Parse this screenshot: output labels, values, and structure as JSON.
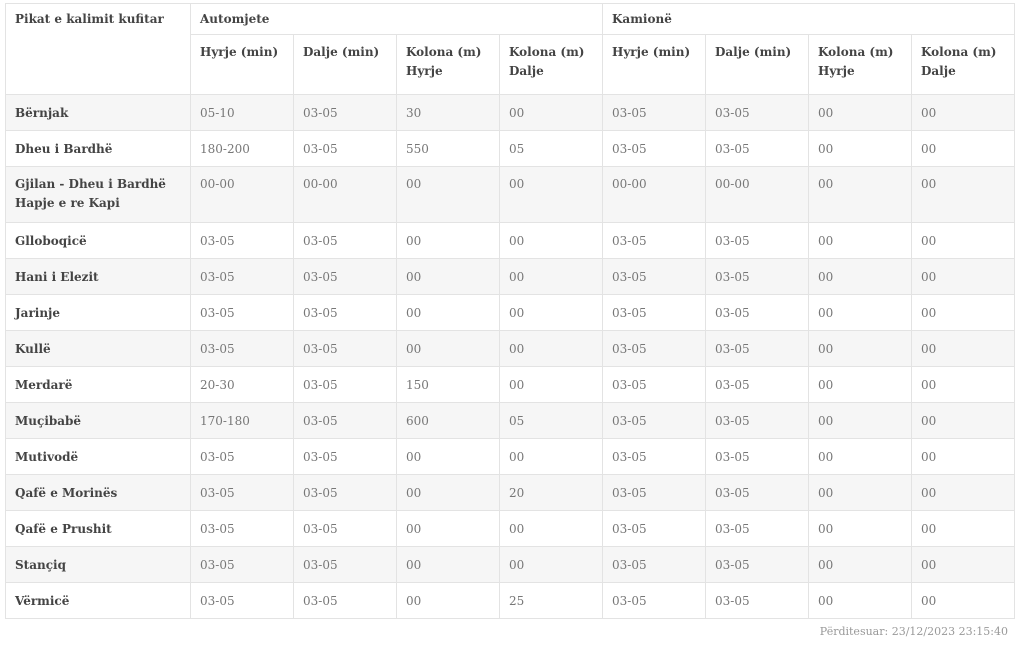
{
  "table": {
    "corner_header": "Pikat e kalimit kufitar",
    "groups": [
      "Automjete",
      "Kamionë"
    ],
    "subheaders": [
      [
        "Hyrje (min)"
      ],
      [
        "Dalje (min)"
      ],
      [
        "Kolona (m)",
        "Hyrje"
      ],
      [
        "Kolona (m)",
        "Dalje"
      ],
      [
        "Hyrje (min)"
      ],
      [
        "Dalje (min)"
      ],
      [
        "Kolona (m)",
        "Hyrje"
      ],
      [
        "Kolona (m)",
        "Dalje"
      ]
    ],
    "rows": [
      {
        "name": [
          "Bërnjak"
        ],
        "values": [
          "05-10",
          "03-05",
          "30",
          "00",
          "03-05",
          "03-05",
          "00",
          "00"
        ]
      },
      {
        "name": [
          "Dheu i Bardhë"
        ],
        "values": [
          "180-200",
          "03-05",
          "550",
          "05",
          "03-05",
          "03-05",
          "00",
          "00"
        ]
      },
      {
        "name": [
          "Gjilan - Dheu i Bardhë",
          "Hapje e re Kapi"
        ],
        "values": [
          "00-00",
          "00-00",
          "00",
          "00",
          "00-00",
          "00-00",
          "00",
          "00"
        ]
      },
      {
        "name": [
          "Glloboqicë"
        ],
        "values": [
          "03-05",
          "03-05",
          "00",
          "00",
          "03-05",
          "03-05",
          "00",
          "00"
        ]
      },
      {
        "name": [
          "Hani i Elezit"
        ],
        "values": [
          "03-05",
          "03-05",
          "00",
          "00",
          "03-05",
          "03-05",
          "00",
          "00"
        ]
      },
      {
        "name": [
          "Jarinje"
        ],
        "values": [
          "03-05",
          "03-05",
          "00",
          "00",
          "03-05",
          "03-05",
          "00",
          "00"
        ]
      },
      {
        "name": [
          "Kullë"
        ],
        "values": [
          "03-05",
          "03-05",
          "00",
          "00",
          "03-05",
          "03-05",
          "00",
          "00"
        ]
      },
      {
        "name": [
          "Merdarë"
        ],
        "values": [
          "20-30",
          "03-05",
          "150",
          "00",
          "03-05",
          "03-05",
          "00",
          "00"
        ]
      },
      {
        "name": [
          "Muçibabë"
        ],
        "values": [
          "170-180",
          "03-05",
          "600",
          "05",
          "03-05",
          "03-05",
          "00",
          "00"
        ]
      },
      {
        "name": [
          "Mutivodë"
        ],
        "values": [
          "03-05",
          "03-05",
          "00",
          "00",
          "03-05",
          "03-05",
          "00",
          "00"
        ]
      },
      {
        "name": [
          "Qafë e Morinës"
        ],
        "values": [
          "03-05",
          "03-05",
          "00",
          "20",
          "03-05",
          "03-05",
          "00",
          "00"
        ]
      },
      {
        "name": [
          "Qafë e Prushit"
        ],
        "values": [
          "03-05",
          "03-05",
          "00",
          "00",
          "03-05",
          "03-05",
          "00",
          "00"
        ]
      },
      {
        "name": [
          "Stançiq"
        ],
        "values": [
          "03-05",
          "03-05",
          "00",
          "00",
          "03-05",
          "03-05",
          "00",
          "00"
        ]
      },
      {
        "name": [
          "Vërmicë"
        ],
        "values": [
          "03-05",
          "03-05",
          "00",
          "25",
          "03-05",
          "03-05",
          "00",
          "00"
        ]
      }
    ]
  },
  "updated": {
    "text": "Përditesuar: 23/12/2023 23:15:40"
  }
}
